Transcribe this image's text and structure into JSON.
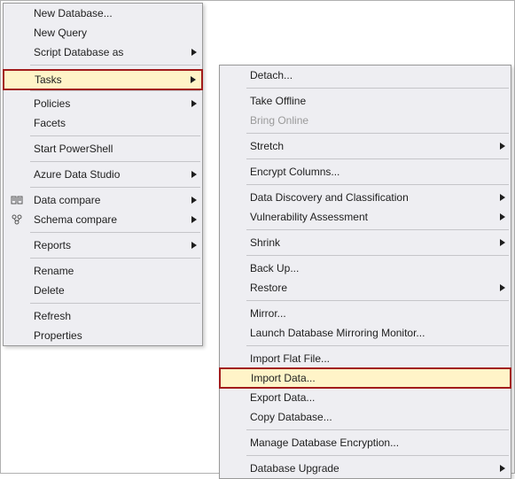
{
  "menu1": {
    "new_database": "New Database...",
    "new_query": "New Query",
    "script_db_as": "Script Database as",
    "tasks": "Tasks",
    "policies": "Policies",
    "facets": "Facets",
    "start_powershell": "Start PowerShell",
    "azure_data_studio": "Azure Data Studio",
    "data_compare": "Data compare",
    "schema_compare": "Schema compare",
    "reports": "Reports",
    "rename": "Rename",
    "delete": "Delete",
    "refresh": "Refresh",
    "properties": "Properties"
  },
  "menu2": {
    "detach": "Detach...",
    "take_offline": "Take Offline",
    "bring_online": "Bring Online",
    "stretch": "Stretch",
    "encrypt_columns": "Encrypt Columns...",
    "data_discovery": "Data Discovery and Classification",
    "vulnerability": "Vulnerability Assessment",
    "shrink": "Shrink",
    "back_up": "Back Up...",
    "restore": "Restore",
    "mirror": "Mirror...",
    "launch_mirror_monitor": "Launch Database Mirroring Monitor...",
    "import_flat_file": "Import Flat File...",
    "import_data": "Import Data...",
    "export_data": "Export Data...",
    "copy_database": "Copy Database...",
    "manage_encryption": "Manage Database Encryption...",
    "database_upgrade": "Database Upgrade"
  }
}
